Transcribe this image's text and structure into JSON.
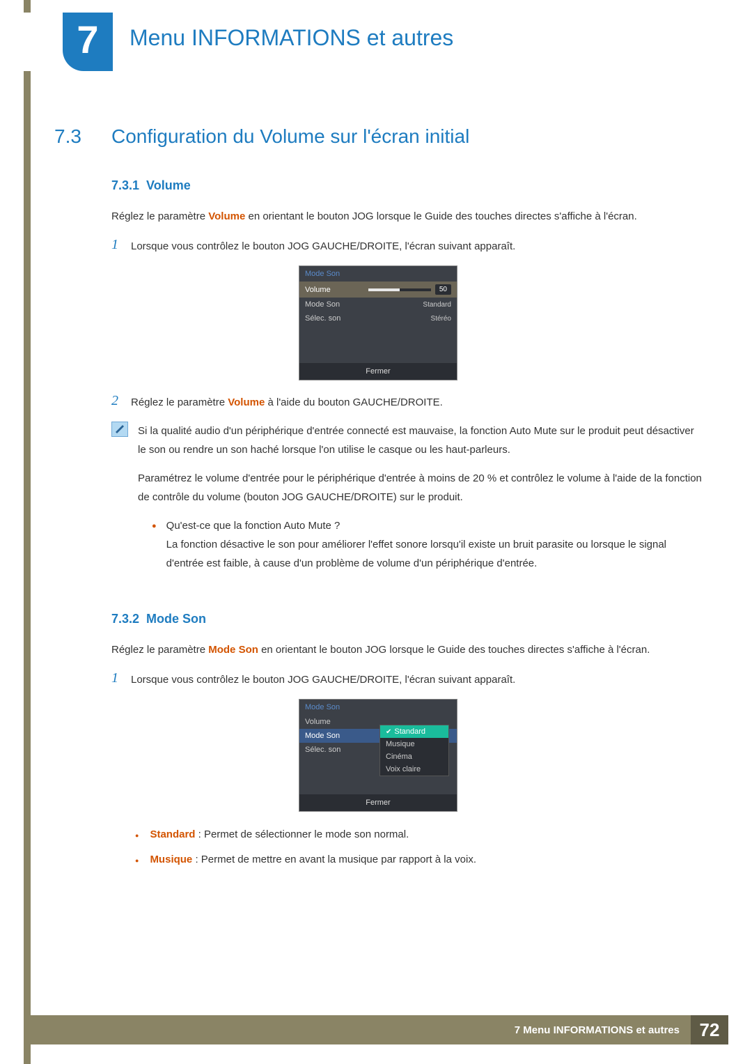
{
  "chapter": {
    "number": "7",
    "title": "Menu INFORMATIONS et autres"
  },
  "section": {
    "number": "7.3",
    "title": "Configuration du Volume sur l'écran initial"
  },
  "sub1": {
    "number": "7.3.1",
    "title": "Volume",
    "intro_pre": "Réglez le paramètre ",
    "intro_bold": "Volume",
    "intro_post": " en orientant le bouton JOG lorsque le Guide des touches directes s'affiche à l'écran.",
    "step1": "Lorsque vous contrôlez le bouton JOG GAUCHE/DROITE, l'écran suivant apparaît.",
    "step2_pre": "Réglez le paramètre ",
    "step2_bold": "Volume",
    "step2_post": " à l'aide du bouton GAUCHE/DROITE."
  },
  "osd1": {
    "header": "Mode Son",
    "row_volume": "Volume",
    "row_volume_value": "50",
    "row_modeson": "Mode Son",
    "row_modeson_value": "Standard",
    "row_selec": "Sélec. son",
    "row_selec_value": "Stéréo",
    "close": "Fermer"
  },
  "note": {
    "p1": "Si la qualité audio d'un périphérique d'entrée connecté est mauvaise, la fonction Auto Mute sur le produit peut désactiver le son ou rendre un son haché lorsque l'on utilise le casque ou les haut-parleurs.",
    "p2": "Paramétrez le volume d'entrée pour le périphérique d'entrée à moins de 20 % et contrôlez le volume à l'aide de la fonction de contrôle du volume (bouton JOG GAUCHE/DROITE) sur le produit.",
    "bullet_q": "Qu'est-ce que la fonction Auto Mute ?",
    "bullet_a": "La fonction désactive le son pour améliorer l'effet sonore lorsqu'il existe un bruit parasite ou lorsque le signal d'entrée est faible, à cause d'un problème de volume d'un périphérique d'entrée."
  },
  "sub2": {
    "number": "7.3.2",
    "title": "Mode Son",
    "intro_pre": "Réglez le paramètre ",
    "intro_bold": "Mode Son",
    "intro_post": " en orientant le bouton JOG lorsque le Guide des touches directes s'affiche à l'écran.",
    "step1": "Lorsque vous contrôlez le bouton JOG GAUCHE/DROITE, l'écran suivant apparaît."
  },
  "osd2": {
    "header": "Mode Son",
    "row_volume": "Volume",
    "row_modeson": "Mode Son",
    "row_selec": "Sélec. son",
    "dropdown": {
      "opt1": "Standard",
      "opt2": "Musique",
      "opt3": "Cinéma",
      "opt4": "Voix claire"
    },
    "close": "Fermer"
  },
  "bullets2": {
    "b1_bold": "Standard",
    "b1_text": " : Permet de sélectionner le mode son normal.",
    "b2_bold": "Musique",
    "b2_text": " : Permet de mettre en avant la musique par rapport à la voix."
  },
  "footer": {
    "text": "7 Menu INFORMATIONS et autres",
    "page": "72"
  }
}
